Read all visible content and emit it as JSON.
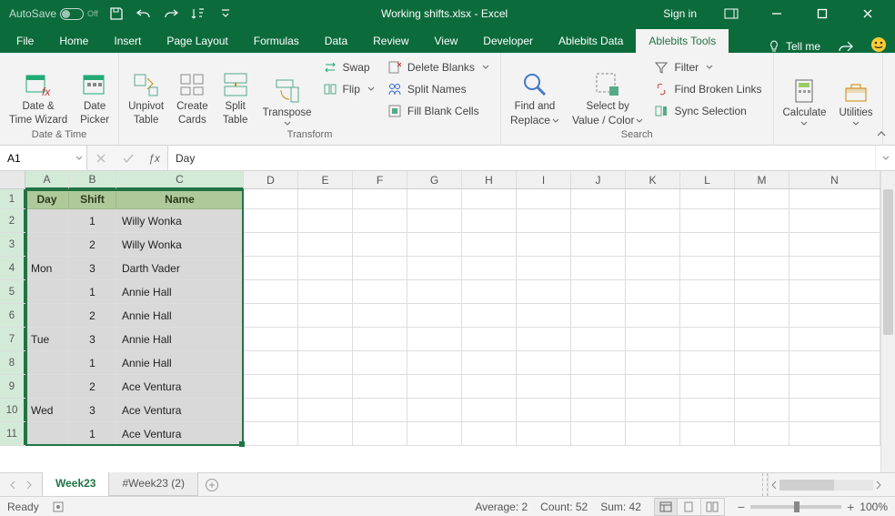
{
  "title": {
    "autosave": "AutoSave",
    "autosave_state": "Off",
    "doc": "Working shifts.xlsx",
    "app_sep": "  -  ",
    "app": "Excel",
    "signin": "Sign in"
  },
  "tabs": {
    "file": "File",
    "home": "Home",
    "insert": "Insert",
    "pagelayout": "Page Layout",
    "formulas": "Formulas",
    "data": "Data",
    "review": "Review",
    "view": "View",
    "developer": "Developer",
    "abdata": "Ablebits Data",
    "abtools": "Ablebits Tools",
    "tellme": "Tell me"
  },
  "ribbon": {
    "datetime": {
      "date_time_wizard_l1": "Date &",
      "date_time_wizard_l2": "Time Wizard",
      "date_picker_l1": "Date",
      "date_picker_l2": "Picker",
      "group": "Date & Time"
    },
    "transform": {
      "unpivot_l1": "Unpivot",
      "unpivot_l2": "Table",
      "create_l1": "Create",
      "create_l2": "Cards",
      "split_l1": "Split",
      "split_l2": "Table",
      "transpose": "Transpose",
      "swap": "Swap",
      "flip": "Flip",
      "delete_blanks": "Delete Blanks",
      "split_names": "Split Names",
      "fill_blank": "Fill Blank Cells",
      "group": "Transform"
    },
    "search": {
      "find_l1": "Find and",
      "find_l2": "Replace",
      "select_l1": "Select by",
      "select_l2": "Value / Color",
      "filter": "Filter",
      "find_links": "Find Broken Links",
      "sync_sel": "Sync Selection",
      "group": "Search"
    },
    "calculate": "Calculate",
    "utilities": "Utilities"
  },
  "formula": {
    "ref": "A1",
    "value": "Day"
  },
  "columns": [
    "A",
    "B",
    "C",
    "D",
    "E",
    "F",
    "G",
    "H",
    "I",
    "J",
    "K",
    "L",
    "M",
    "N"
  ],
  "headers": {
    "day": "Day",
    "shift": "Shift",
    "name": "Name"
  },
  "rows": [
    {
      "day": "",
      "shift": "1",
      "name": "Willy Wonka"
    },
    {
      "day": "",
      "shift": "2",
      "name": "Willy Wonka"
    },
    {
      "day": "Mon",
      "shift": "3",
      "name": "Darth Vader"
    },
    {
      "day": "",
      "shift": "1",
      "name": "Annie Hall"
    },
    {
      "day": "",
      "shift": "2",
      "name": "Annie Hall"
    },
    {
      "day": "Tue",
      "shift": "3",
      "name": "Annie Hall"
    },
    {
      "day": "",
      "shift": "1",
      "name": "Annie Hall"
    },
    {
      "day": "",
      "shift": "2",
      "name": "Ace Ventura"
    },
    {
      "day": "Wed",
      "shift": "3",
      "name": "Ace Ventura"
    },
    {
      "day": "",
      "shift": "1",
      "name": "Ace Ventura"
    }
  ],
  "sheets": {
    "active": "Week23",
    "second": "#Week23 (2)"
  },
  "status": {
    "ready": "Ready",
    "average": "Average: 2",
    "count": "Count: 52",
    "sum": "Sum: 42",
    "zoom": "100%"
  }
}
